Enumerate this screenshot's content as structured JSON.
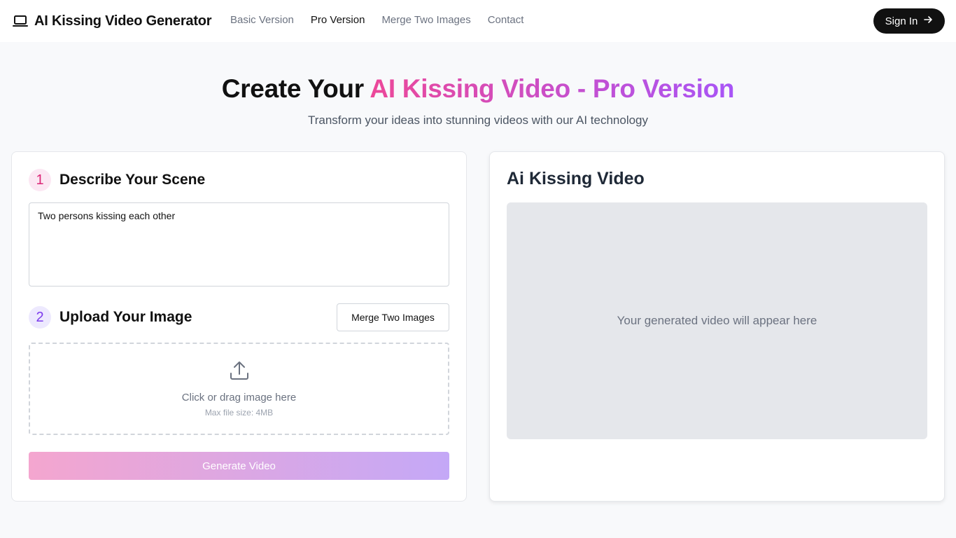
{
  "header": {
    "brand": "AI Kissing Video Generator",
    "brand_icon": "laptop-icon",
    "nav": [
      {
        "label": "Basic Version",
        "active": false
      },
      {
        "label": "Pro Version",
        "active": true
      },
      {
        "label": "Merge Two Images",
        "active": false
      },
      {
        "label": "Contact",
        "active": false
      }
    ],
    "signin_label": "Sign In"
  },
  "hero": {
    "title_plain": "Create Your ",
    "title_highlight": "AI Kissing Video - Pro Version",
    "subtitle": "Transform your ideas into stunning videos with our AI technology"
  },
  "form": {
    "step1": {
      "number": "1",
      "title": "Describe Your Scene"
    },
    "prompt_value": "Two persons kissing each other",
    "step2": {
      "number": "2",
      "title": "Upload Your Image"
    },
    "merge_button": "Merge Two Images",
    "dropzone": {
      "icon": "upload-icon",
      "text": "Click or drag image here",
      "hint": "Max file size: 4MB"
    },
    "generate_button": "Generate Video"
  },
  "preview": {
    "title": "Ai Kissing Video",
    "placeholder": "Your generated video will appear here"
  },
  "colors": {
    "accent_pink": "#ec4899",
    "accent_purple": "#a855f7",
    "primary_dark": "#111111"
  }
}
